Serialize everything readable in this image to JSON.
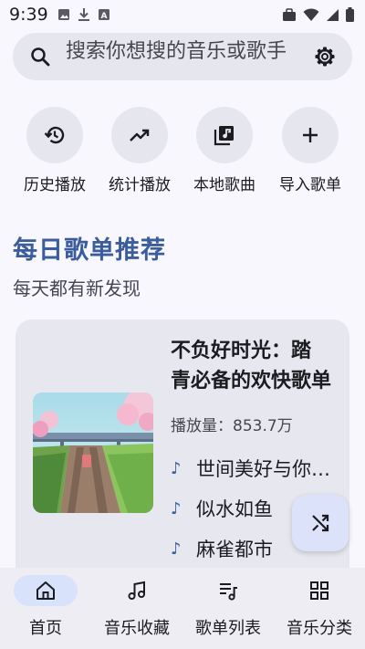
{
  "status_bar": {
    "time": "9:39",
    "icons_left": [
      "image-icon",
      "download-icon",
      "font-icon"
    ],
    "icons_right": [
      "briefcase-icon",
      "wifi-icon",
      "signal-icon",
      "battery-icon"
    ]
  },
  "search": {
    "placeholder": "搜索你想搜的音乐或歌手",
    "icon": "search-icon",
    "settings_icon": "settings-icon"
  },
  "quick_actions": [
    {
      "label": "历史播放",
      "icon": "history-icon"
    },
    {
      "label": "统计播放",
      "icon": "trending-up-icon"
    },
    {
      "label": "本地歌曲",
      "icon": "music-library-icon"
    },
    {
      "label": "导入歌单",
      "icon": "plus-icon"
    }
  ],
  "section": {
    "title": "每日歌单推荐",
    "subtitle": "每天都有新发现"
  },
  "playlist": {
    "title_line1": "不负好时光：踏",
    "title_line2": "青必备的欢快歌单",
    "play_count": "播放量：853.7万",
    "songs": [
      "世间美好与你环环相扣",
      "似水如鱼",
      "麻雀都市"
    ]
  },
  "fab": {
    "icon": "shuffle-icon"
  },
  "bottom_nav": {
    "items": [
      {
        "label": "首页",
        "icon": "home-icon",
        "active": true
      },
      {
        "label": "音乐收藏",
        "icon": "music-note-icon",
        "active": false
      },
      {
        "label": "歌单列表",
        "icon": "playlist-icon",
        "active": false
      },
      {
        "label": "音乐分类",
        "icon": "category-grid-icon",
        "active": false
      }
    ]
  },
  "colors": {
    "accent": "#3b5d9c",
    "background": "#f7f7fd",
    "surface": "#e6e6ee",
    "nav_active": "#d9e2fb"
  }
}
